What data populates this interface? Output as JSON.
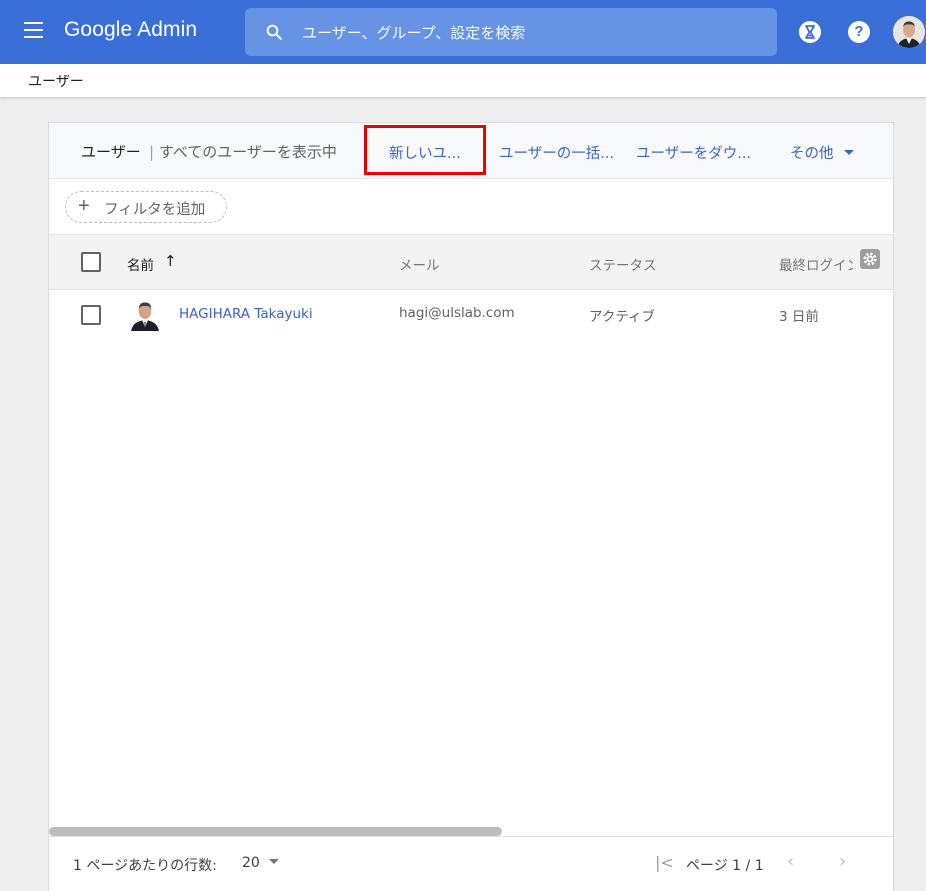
{
  "header": {
    "app_name": "Google Admin",
    "search_placeholder": "ユーザー、グループ、設定を検索",
    "help_glyph": "?",
    "colors": {
      "bar": "#3a6fd8",
      "search": "#6793e4"
    }
  },
  "breadcrumb": {
    "current": "ユーザー"
  },
  "card": {
    "title": "ユーザー",
    "separator": "|",
    "subtitle": "すべてのユーザーを表示中",
    "actions": {
      "add_new": "新しいユ...",
      "bulk_update": "ユーザーの一括...",
      "download": "ユーザーをダウ...",
      "more": "その他"
    },
    "filter": {
      "plus": "+",
      "label": "フィルタを追加"
    },
    "columns": {
      "name": "名前",
      "sort_indicator": "↑",
      "email": "メール",
      "status": "ステータス",
      "last_login": "最終ログイン"
    },
    "rows": [
      {
        "name": "HAGIHARA Takayuki",
        "email": "hagi@ulslab.com",
        "status": "アクティブ",
        "last_login": "3 日前"
      }
    ],
    "footer": {
      "rows_per_page_label": "1 ページあたりの行数:",
      "rows_per_page_value": "20",
      "page_label": "ページ 1 / 1"
    }
  },
  "icons": {
    "menu": "menu-icon",
    "search": "search-icon",
    "hourglass": "hourglass-icon",
    "help": "help-icon",
    "settings": "gear-icon",
    "first_page": "first-page-icon",
    "prev": "chevron-left-icon",
    "next": "chevron-right-icon"
  },
  "highlight_color": "#ee0000"
}
